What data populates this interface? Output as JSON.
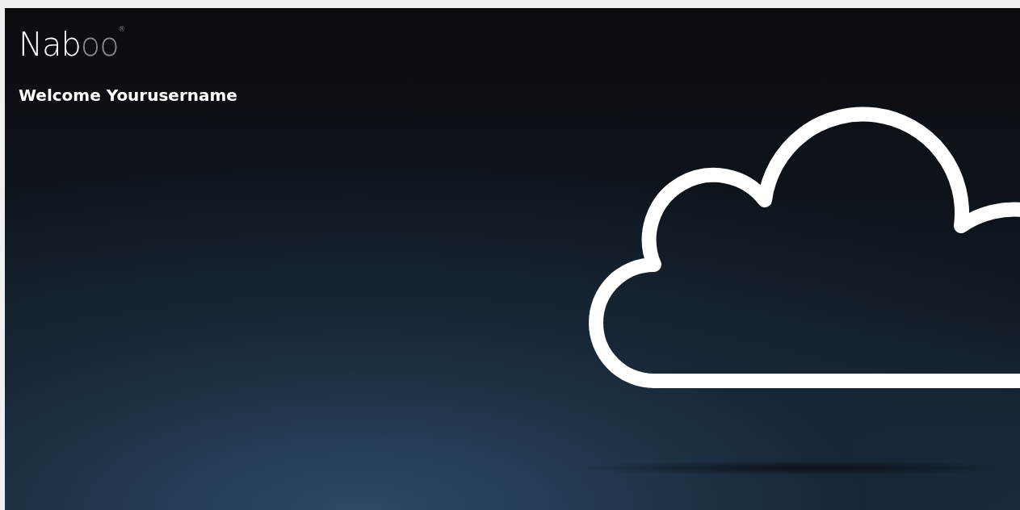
{
  "logo": {
    "primary": "Nab",
    "secondary": "oo",
    "mark": "®"
  },
  "welcome": "Welcome Yourusername"
}
